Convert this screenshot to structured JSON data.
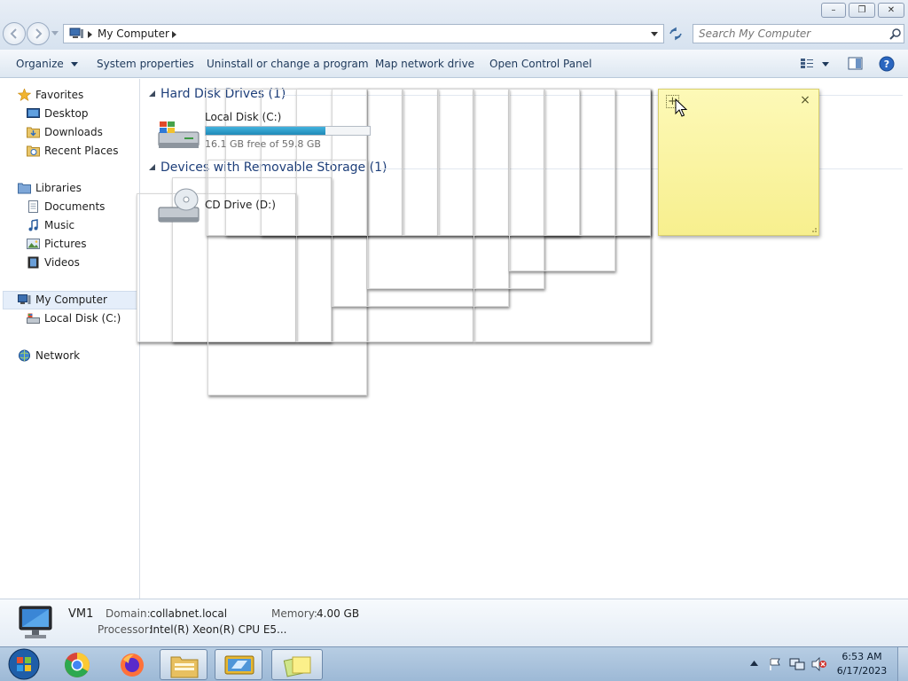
{
  "window": {
    "minimize_glyph": "–",
    "restore_glyph": "❐",
    "close_glyph": "✕"
  },
  "address_bar": {
    "location": "My Computer",
    "search_placeholder": "Search My Computer"
  },
  "toolbar": {
    "organize": "Organize",
    "system_properties": "System properties",
    "uninstall": "Uninstall or change a program",
    "map_network_drive": "Map network drive",
    "open_control_panel": "Open Control Panel"
  },
  "nav": {
    "favorites": "Favorites",
    "desktop": "Desktop",
    "downloads": "Downloads",
    "recent_places": "Recent Places",
    "libraries": "Libraries",
    "documents": "Documents",
    "music": "Music",
    "pictures": "Pictures",
    "videos": "Videos",
    "my_computer": "My Computer",
    "local_disk": "Local Disk (C:)",
    "network": "Network"
  },
  "content": {
    "hard_disk_group": "Hard Disk Drives (1)",
    "removable_group": "Devices with Removable Storage (1)",
    "local_disk": {
      "name": "Local Disk (C:)",
      "free_text": "16.1 GB free of 59.8 GB",
      "used_fraction": 0.73
    },
    "cd_drive": {
      "name": "CD Drive (D:)"
    }
  },
  "sticky_note": {
    "add_glyph": "+",
    "close_glyph": "×",
    "color": "#fbf5a6"
  },
  "details": {
    "computer_name": "VM1",
    "domain_label": "Domain:",
    "domain_value": "collabnet.local",
    "memory_label": "Memory:",
    "memory_value": "4.00 GB",
    "processor_label": "Processor:",
    "processor_value": "Intel(R) Xeon(R) CPU E5..."
  },
  "taskbar": {
    "time": "6:53 AM",
    "date": "6/17/2023",
    "apps": [
      "start-orb",
      "chrome",
      "firefox",
      "windows-explorer",
      "remote-desktop",
      "sticky-notes"
    ]
  }
}
